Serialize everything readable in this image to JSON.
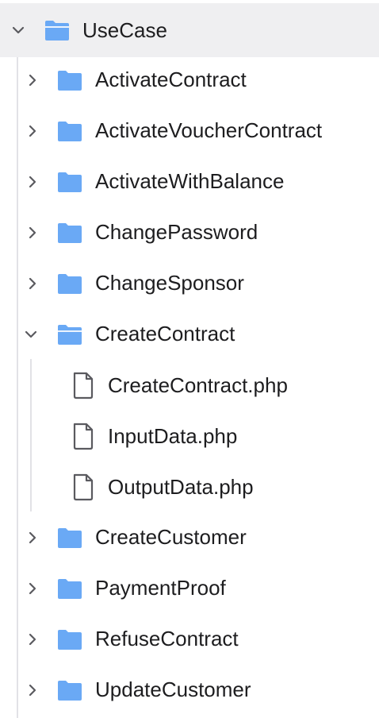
{
  "root": {
    "label": "UseCase",
    "expanded": true
  },
  "folders_before": [
    {
      "label": "ActivateContract"
    },
    {
      "label": "ActivateVoucherContract"
    },
    {
      "label": "ActivateWithBalance"
    },
    {
      "label": "ChangePassword"
    },
    {
      "label": "ChangeSponsor"
    }
  ],
  "open_folder": {
    "label": "CreateContract",
    "expanded": true,
    "files": [
      {
        "label": "CreateContract.php"
      },
      {
        "label": "InputData.php"
      },
      {
        "label": "OutputData.php"
      }
    ]
  },
  "folders_after": [
    {
      "label": "CreateCustomer"
    },
    {
      "label": "PaymentProof"
    },
    {
      "label": "RefuseContract"
    },
    {
      "label": "UpdateCustomer"
    }
  ],
  "colors": {
    "folder": "#6aa9f5",
    "chevron": "#5a5a5f",
    "selected_bg": "#efeff1",
    "file_icon": "#5a5a5f"
  }
}
